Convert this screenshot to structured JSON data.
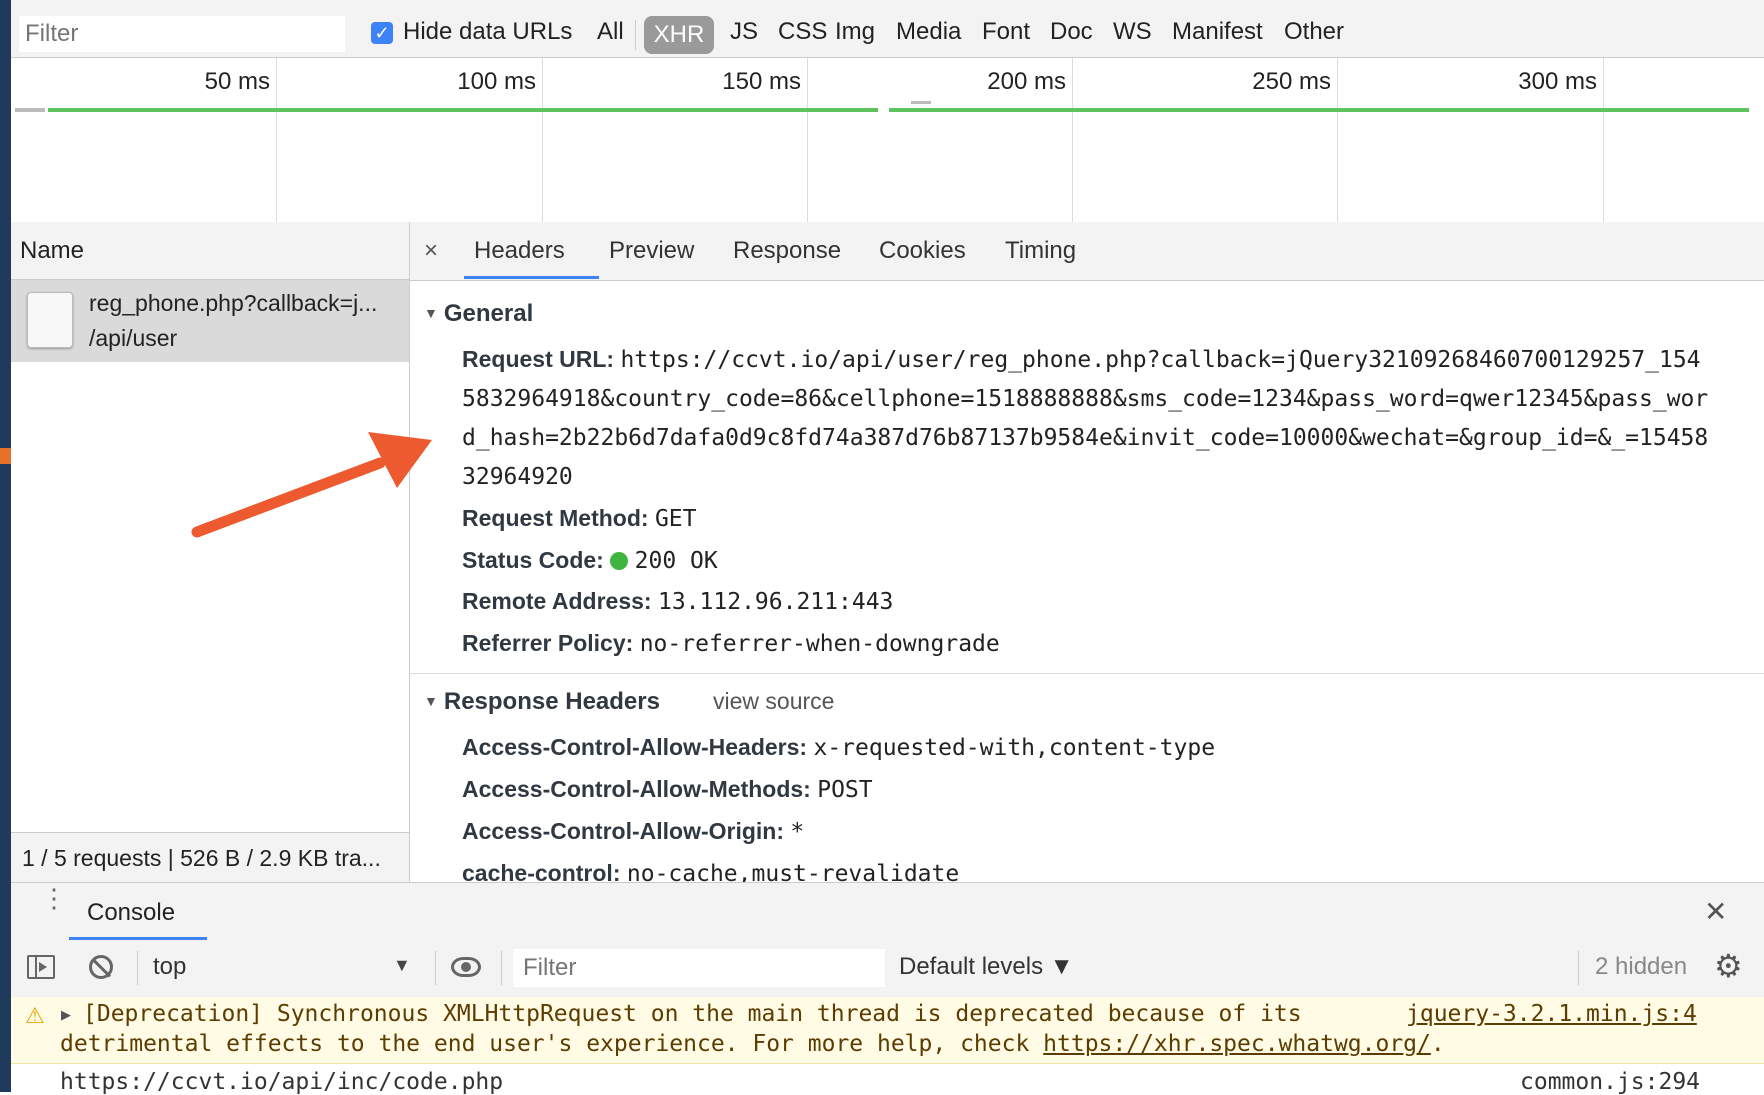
{
  "filter_bar": {
    "filter_placeholder": "Filter",
    "hide_data_urls_label": "Hide data URLs",
    "types": [
      "All",
      "XHR",
      "JS",
      "CSS",
      "Img",
      "Media",
      "Font",
      "Doc",
      "WS",
      "Manifest",
      "Other"
    ],
    "selected_type": "XHR"
  },
  "overview": {
    "ticks": [
      "50 ms",
      "100 ms",
      "150 ms",
      "200 ms",
      "250 ms",
      "300 ms"
    ]
  },
  "requests": {
    "column_header": "Name",
    "items": [
      {
        "name": "reg_phone.php?callback=j...",
        "path": "/api/user"
      }
    ],
    "summary": "1 / 5 requests | 526 B / 2.9 KB tra..."
  },
  "detail_tabs": {
    "close": "×",
    "tabs": [
      "Headers",
      "Preview",
      "Response",
      "Cookies",
      "Timing"
    ],
    "active": "Headers"
  },
  "general": {
    "title": "General",
    "request_url_label": "Request URL:",
    "request_url_lines": [
      "https://ccvt.io/api/user/reg_phone.php?callback=jQuery32109268460700129257_154",
      "5832964918&country_code=86&cellphone=1518888888&sms_code=1234&pass_word=qwer12345&pass_wor",
      "d_hash=2b22b6d7dafa0d9c8fd74a387d76b87137b9584e&invit_code=10000&wechat=&group_id=&_=15458",
      "32964920"
    ],
    "request_method_label": "Request Method:",
    "request_method": "GET",
    "status_code_label": "Status Code:",
    "status_code": "200  OK",
    "status_color": "#3fb53f",
    "remote_address_label": "Remote Address:",
    "remote_address": "13.112.96.211:443",
    "referrer_policy_label": "Referrer Policy:",
    "referrer_policy": "no-referrer-when-downgrade"
  },
  "response_headers": {
    "title": "Response Headers",
    "view_source": "view source",
    "items": [
      {
        "name": "Access-Control-Allow-Headers:",
        "value": "x-requested-with,content-type"
      },
      {
        "name": "Access-Control-Allow-Methods:",
        "value": "POST"
      },
      {
        "name": "Access-Control-Allow-Origin:",
        "value": "*"
      },
      {
        "name": "cache-control:",
        "value": "no-cache,must-revalidate"
      }
    ]
  },
  "console": {
    "tab_label": "Console",
    "context": "top",
    "filter_placeholder": "Filter",
    "levels": "Default levels ▼",
    "hidden": "2 hidden",
    "warning_line1": "[Deprecation] Synchronous XMLHttpRequest on the main thread is deprecated because of its",
    "warning_source": "jquery-3.2.1.min.js:4",
    "warning_line2_pre": "detrimental effects to the end user's experience. For more help, check ",
    "warning_link": "https://xhr.spec.whatwg.org/",
    "warning_line2_post": ".",
    "next_url": "https://ccvt.io/api/inc/code.php",
    "next_source": "common.js:294"
  },
  "colors": {
    "accent": "#3e82f7",
    "arrow": "#ee5a2f",
    "green": "#5ec35e",
    "warning_bg": "#fffbe5"
  }
}
